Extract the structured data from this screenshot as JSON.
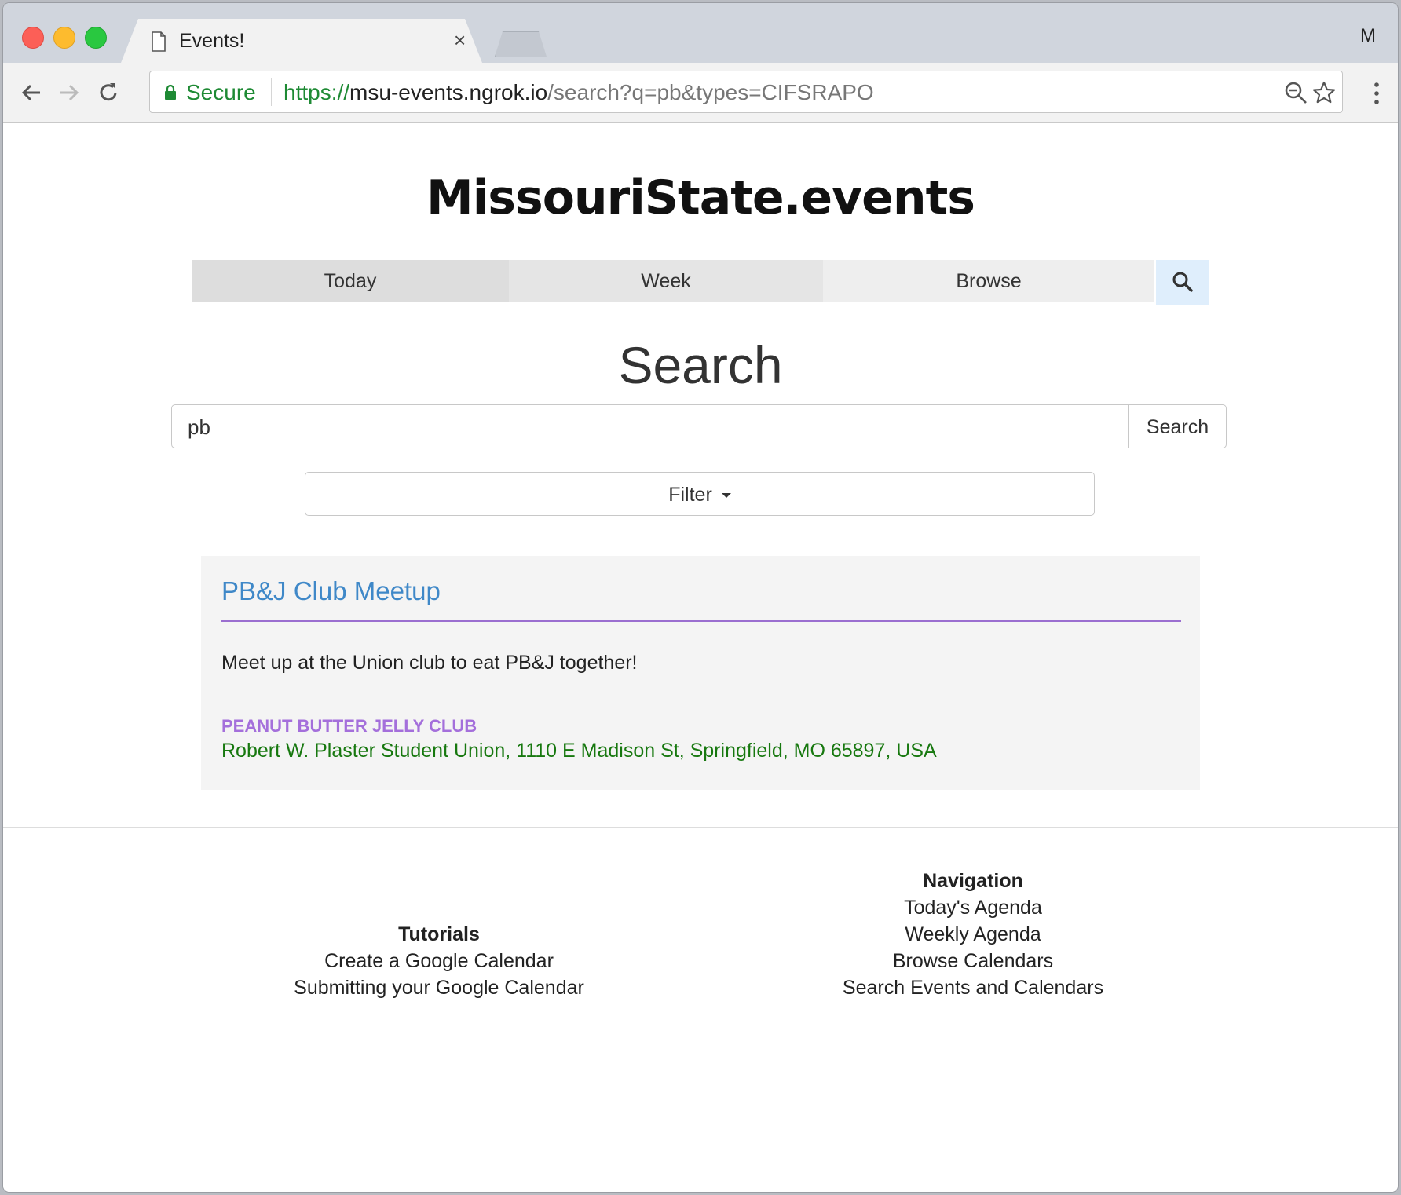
{
  "browser": {
    "tab_title": "Events!",
    "tab_close": "×",
    "profile_initial": "M",
    "secure_label": "Secure",
    "url_scheme": "https://",
    "url_host": "msu-events.ngrok.io",
    "url_path": "/search?q=pb&types=CIFSRAPO"
  },
  "site": {
    "logo": "MissouriState.events"
  },
  "nav": {
    "tabs": [
      "Today",
      "Week",
      "Browse"
    ]
  },
  "search": {
    "heading": "Search",
    "query": "pb",
    "button": "Search",
    "filter": "Filter"
  },
  "results": [
    {
      "title": "PB&J Club Meetup",
      "description": "Meet up at the Union club to eat PB&J together!",
      "organization": "PEANUT BUTTER JELLY CLUB",
      "location": "Robert W. Plaster Student Union, 1110 E Madison St, Springfield, MO 65897, USA"
    }
  ],
  "footer": {
    "tutorials": {
      "heading": "Tutorials",
      "links": [
        "Create a Google Calendar",
        "Submitting your Google Calendar"
      ]
    },
    "navigation": {
      "heading": "Navigation",
      "links": [
        "Today's Agenda",
        "Weekly Agenda",
        "Browse Calendars",
        "Search Events and Calendars"
      ]
    }
  },
  "colors": {
    "link_blue": "#3f88c8",
    "org_purple": "#a46fdb",
    "location_green": "#17780f",
    "secure_green": "#1e8a34"
  }
}
